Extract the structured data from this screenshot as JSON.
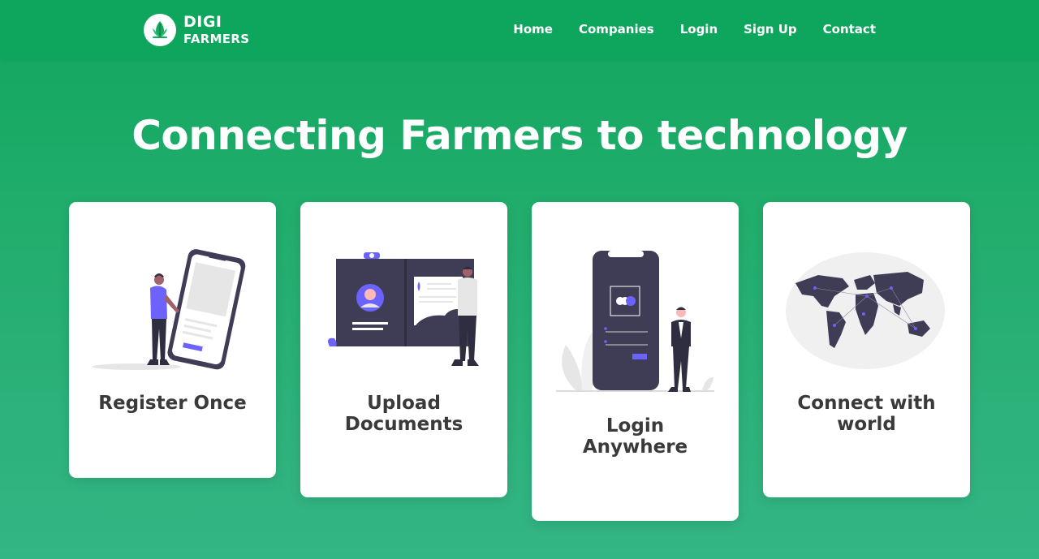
{
  "nav": {
    "logo_line1": "DIGI",
    "logo_line2": "FARMERS",
    "links": [
      "Home",
      "Companies",
      "Login",
      "Sign Up",
      "Contact"
    ]
  },
  "hero": {
    "title": "Connecting Farmers to technology"
  },
  "cards": [
    {
      "title": "Register Once",
      "illustration": "person-with-phone"
    },
    {
      "title": "Upload Documents",
      "illustration": "person-with-id-card"
    },
    {
      "title": "Login Anywhere",
      "illustration": "person-with-login-phone"
    },
    {
      "title": "Connect with world",
      "illustration": "world-map"
    }
  ],
  "colors": {
    "nav_bg": "#0ea55d",
    "page_gradient_top": "#0fa75e",
    "page_gradient_bottom": "#34b584",
    "accent_purple": "#6c63ff",
    "dark_illustration": "#3f3d56"
  }
}
